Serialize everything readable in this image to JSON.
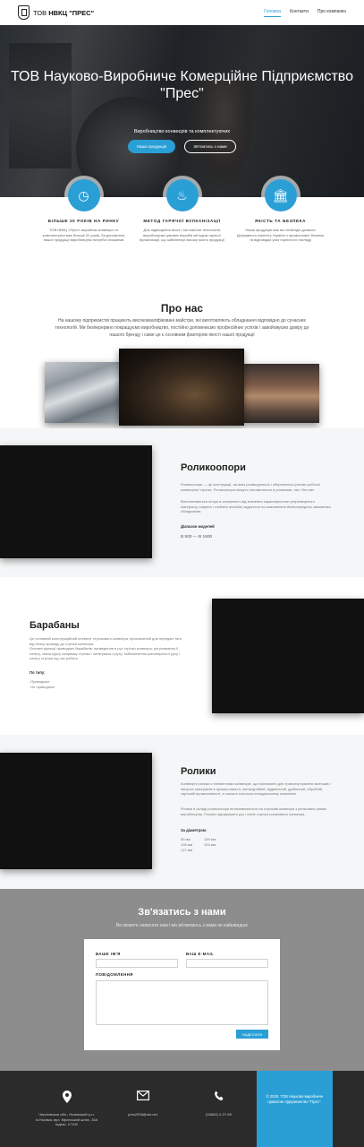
{
  "header": {
    "logo_prefix": "ТОВ",
    "logo_name": "НВКЦ \"ПРЕС\"",
    "nav": [
      {
        "label": "Головна",
        "active": true
      },
      {
        "label": "Контакти",
        "active": false
      },
      {
        "label": "Про компанію",
        "active": false
      }
    ]
  },
  "hero": {
    "title": "ТОВ Науково-Виробниче Комерційне Підприємство \"Прес\"",
    "subtitle": "Виробництво конвеєрів та комплектуючих",
    "btn_primary": "Наша продукція",
    "btn_outline": "Зв'язатись з нами"
  },
  "features": [
    {
      "icon": "clock-icon",
      "glyph": "◷",
      "title": "БІЛЬШЕ 20 РОКІВ НА РИНКУ",
      "text": "ТОВ НВКЦ «Прес» виробляє конвеєри та комплектуючі вже більше 20 років. За допомогою нашої продукції виробництва потреби спожиачів"
    },
    {
      "icon": "flame-icon",
      "glyph": "♨",
      "title": "МЕТОД ГАРЯЧОЇ ВУЛКАНІЗАЦІЇ",
      "text": "Для підвищення якості, ми освоїли технологію виробництва гумових виробів методом гарячої вулканізації, що забезпечує високу якість продукції"
    },
    {
      "icon": "institution-icon",
      "glyph": "🏛",
      "title": "ЯКІСТЬ ТА БЕЗПЕКА",
      "text": "Наша продукція має всі необхідні дозволи Державного комітету України з промислової безпеки та відповідає усім горнічного нагляду"
    }
  ],
  "about": {
    "title": "Про нас",
    "text": "На нашому підприємстві працюють висококваліфіковані майстри, які виготовляють обладнання відповідно до сучасних технологій. Ми безперервно покращуємо виробництво, постійно доповнюємо професійних успіхів і завойовуємо довіру до нашого бренду і саме це є основним фактором якості нашої продукції"
  },
  "roller_supports": {
    "title": "Роликоопори",
    "text1": "Роликоопори — це конструкції, на яких розміщуються і обертаються ролики робочої конвеєрної стрічки. Роликоопори можуть поставлятися в роликами, так і без них.",
    "text2": "Виготовляються опори в залежності від значення характеристики (переміщеного матеріалу, ширина і глибина жолоба) задається на замовлення безпосередньо замовника обладнання.",
    "label": "Діапазон моделей",
    "value": "В 500 — В 1600"
  },
  "drums": {
    "title": "Барабаны",
    "text1": "Це основний конструкційний елемент стрічкового конвеєра, призначений для передачі тяги від блоку приводу до стрічки конвеєра.",
    "text2": "Основні функції приводних барабанів: приведення в рух стрічки конвеєра; регулювання її натягу; зміна курсу напрямку стрічки і натягувача з руху; забезпечення рівномірності руху і натягу стрічки під час роботи.",
    "label": "По типу:",
    "items": [
      "-Приводные",
      "-Не приводные"
    ]
  },
  "rollers": {
    "title": "Ролики",
    "text1": "Конвеєрні ролики є елементами конвеєрів, що призначені для транспортування вантажів і сипучих матеріалів в промисловості, металургійній, будівельній, дрібнений, обробній, харчовій промисловості, а також в сільськогосподарському комплексі.",
    "text2": "Ролики в складі роликоопори встановлюються на стрічкові конвеєри з рельсових рамах виробництва. Ролики підтримують рух і натяг стрічки роликового конвеєра.",
    "label": "За діаметром:",
    "col1": [
      "89 мм",
      "108 мм",
      "127 мм"
    ],
    "col2": [
      "159 мм",
      "194 мм"
    ]
  },
  "contact": {
    "title": "Зв'язатись з нами",
    "subtitle": "Ви можете написати нам і ми зв'яжемось з вами як найшвидше",
    "name_label": "ВАШЕ ІМ'Я",
    "email_label": "ВАШ E-MAIL",
    "message_label": "ПОВІДОМЛЕННЯ",
    "submit": "НАДІСЛАТИ"
  },
  "footer": {
    "address": "Чернігівська обл., Носівський р-н, м.Носівка, вул. Мринський шлях, 15А індекс: 17100",
    "email": "pres2008@ukr.net",
    "phone": "(04642) 2-27-69",
    "copyright": "© 2020. ТОВ Науково-виробниче приватне підприємство \"Прес\"."
  },
  "colors": {
    "accent": "#2a9fd6",
    "footer": "#2b2b2b",
    "contact_bg": "#8d8d8d"
  }
}
